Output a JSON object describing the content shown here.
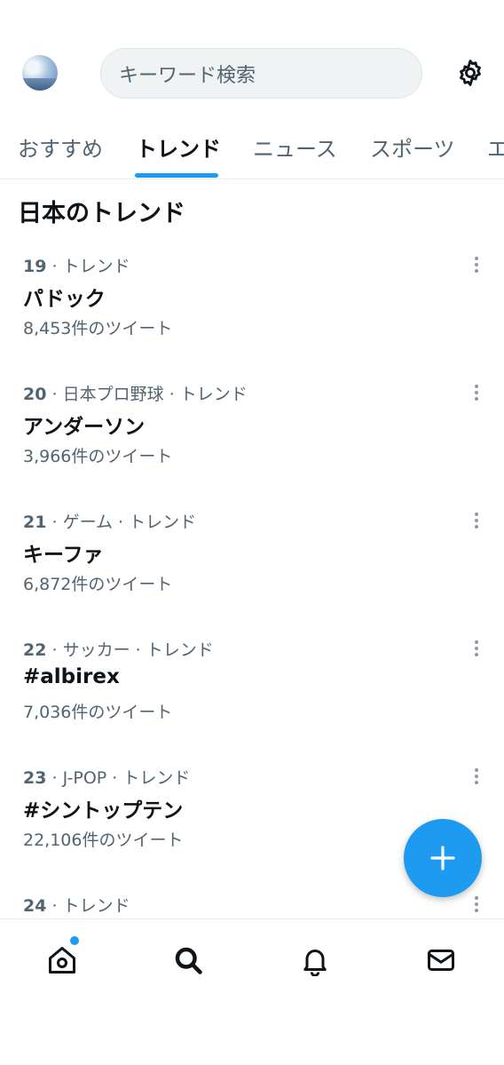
{
  "search": {
    "placeholder": "キーワード検索"
  },
  "tabs": [
    {
      "label": "おすすめ",
      "active": false
    },
    {
      "label": "トレンド",
      "active": true
    },
    {
      "label": "ニュース",
      "active": false
    },
    {
      "label": "スポーツ",
      "active": false
    },
    {
      "label": "エ",
      "active": false
    }
  ],
  "section_title": "日本のトレンド",
  "trends": [
    {
      "rank": "19",
      "context": "トレンド",
      "name": "パドック",
      "count": "8,453件のツイート"
    },
    {
      "rank": "20",
      "context": "日本プロ野球 · トレンド",
      "name": "アンダーソン",
      "count": "3,966件のツイート"
    },
    {
      "rank": "21",
      "context": "ゲーム · トレンド",
      "name": "キーファ",
      "count": "6,872件のツイート"
    },
    {
      "rank": "22",
      "context": "サッカー · トレンド",
      "name": "#albirex",
      "count": "7,036件のツイート"
    },
    {
      "rank": "23",
      "context": "J-POP · トレンド",
      "name": "#シントップテン",
      "count": "22,106件のツイート"
    },
    {
      "rank": "24",
      "context": "トレンド",
      "name": "",
      "count": ""
    }
  ],
  "separator": " · ",
  "icons": {
    "settings": "gear-icon",
    "compose": "plus-icon",
    "home": "home-icon",
    "search": "search-icon",
    "notifications": "bell-icon",
    "messages": "mail-icon"
  },
  "colors": {
    "accent": "#1d9bf0",
    "text": "#0f1419",
    "secondary": "#536471"
  }
}
